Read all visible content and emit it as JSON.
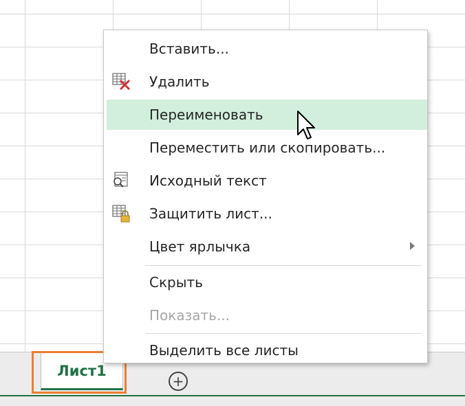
{
  "sheet_tabs": {
    "active_label": "Лист1",
    "add_label": "+"
  },
  "context_menu": {
    "items": [
      {
        "label": "Вставить...",
        "icon": "",
        "enabled": true
      },
      {
        "label": "Удалить",
        "icon": "delete-sheet-icon",
        "enabled": true
      },
      {
        "label": "Переименовать",
        "icon": "",
        "enabled": true,
        "highlighted": true
      },
      {
        "label": "Переместить или скопировать...",
        "icon": "",
        "enabled": true
      },
      {
        "label": "Исходный текст",
        "icon": "view-code-icon",
        "enabled": true
      },
      {
        "label": "Защитить лист...",
        "icon": "protect-sheet-icon",
        "enabled": true
      },
      {
        "label": "Цвет ярлычка",
        "icon": "",
        "enabled": true,
        "submenu": true
      },
      {
        "label": "Скрыть",
        "icon": "",
        "enabled": true
      },
      {
        "label": "Показать...",
        "icon": "",
        "enabled": false
      },
      {
        "label": "Выделить все листы",
        "icon": "",
        "enabled": true
      }
    ]
  },
  "colors": {
    "accent_green": "#217346",
    "highlight_outline": "#ed7d31",
    "hover_background": "#d2eedc"
  }
}
